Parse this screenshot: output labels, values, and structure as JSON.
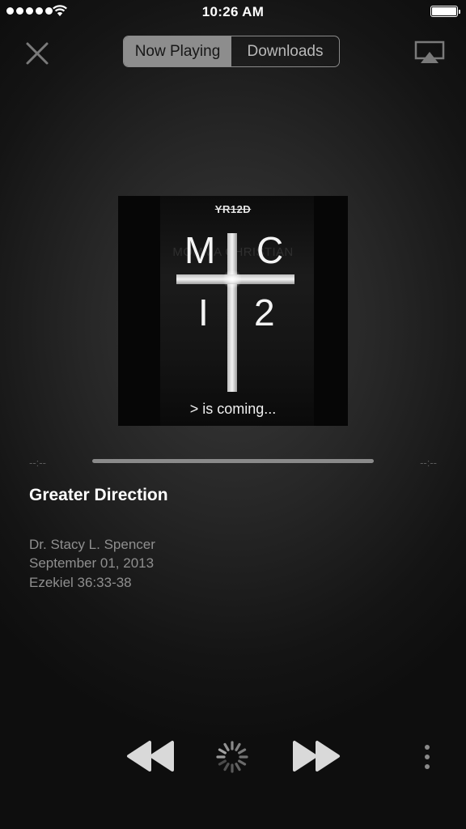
{
  "status_bar": {
    "time": "10:26 AM"
  },
  "top_bar": {
    "tabs": [
      {
        "label": "Now Playing",
        "active": true
      },
      {
        "label": "Downloads",
        "active": false
      }
    ]
  },
  "artwork": {
    "top_label": "YR12D",
    "background_text": "MOMMA CHRISTIAN",
    "letters": [
      "M",
      "C",
      "I",
      "2"
    ],
    "tagline": "> is coming..."
  },
  "progress": {
    "elapsed": "--:--",
    "remaining": "--:--"
  },
  "track": {
    "title": "Greater Direction",
    "speaker": "Dr. Stacy L. Spencer",
    "date": "September 01, 2013",
    "scripture": "Ezekiel 36:33-38"
  },
  "controls": {
    "icons": [
      "close-icon",
      "airplay-icon",
      "rewind-icon",
      "loading-spinner-icon",
      "fast-forward-icon",
      "more-vertical-icon"
    ]
  }
}
